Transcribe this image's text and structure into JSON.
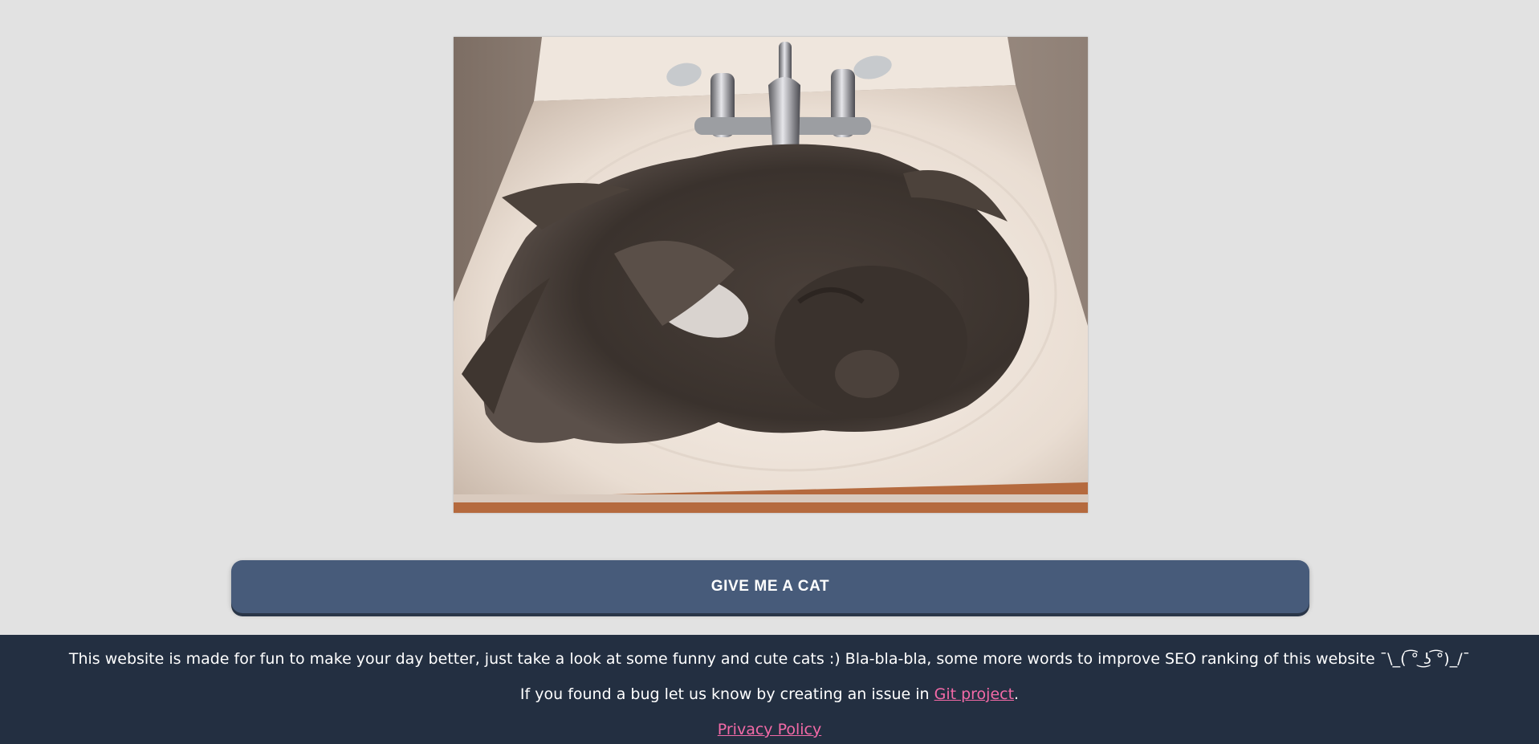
{
  "photo": {
    "alt": "cat"
  },
  "button": {
    "label": "GIVE ME A CAT",
    "color": "#475b7a"
  },
  "footer": {
    "line1": "This website is made for fun to make your day better, just take a look at some funny and cute cats :) Bla-bla-bla, some more words to improve SEO ranking of this website ¯\\_( ͡° ͜ʖ ͡°)_/¯",
    "line2_prefix": "If you found a bug let us know by creating an issue in ",
    "git_link": "Git project",
    "line2_suffix": ".",
    "privacy_link": "Privacy Policy",
    "background": "#232f41",
    "link_color": "#f36aa7"
  },
  "page": {
    "background": "#e2e2e2"
  }
}
